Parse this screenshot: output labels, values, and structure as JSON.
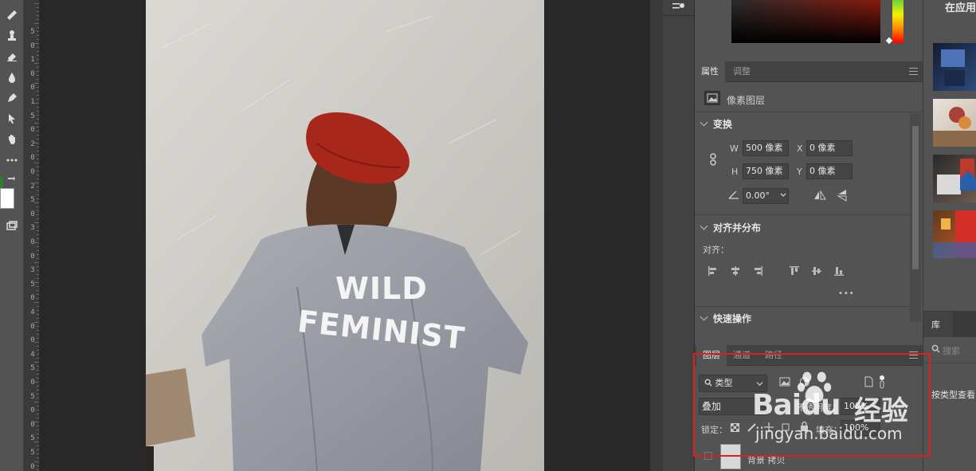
{
  "ruler": {
    "labels": [
      "5",
      "0",
      "1",
      "0",
      "0",
      "1",
      "5",
      "0",
      "2",
      "0",
      "0",
      "2",
      "5",
      "0",
      "3",
      "0",
      "0",
      "3",
      "5",
      "0",
      "4",
      "0",
      "0",
      "4",
      "5",
      "0",
      "5",
      "0",
      "0",
      "5",
      "5",
      "0",
      "6"
    ]
  },
  "artwork": {
    "shirt_text_line1": "WILD",
    "shirt_text_line2": "FEMINIST"
  },
  "properties": {
    "tabs": [
      "属性",
      "调整"
    ],
    "layer_type": "像素图层",
    "transform": {
      "title": "变换",
      "w_label": "W",
      "w_value": "500 像素",
      "h_label": "H",
      "h_value": "750 像素",
      "x_label": "X",
      "x_value": "0 像素",
      "y_label": "Y",
      "y_value": "0 像素",
      "angle_value": "0.00°"
    },
    "align": {
      "title": "对齐并分布",
      "label": "对齐：",
      "more": "•••"
    },
    "quick": {
      "title": "快速操作"
    }
  },
  "layers": {
    "tabs": [
      "图层",
      "通道",
      "路径"
    ],
    "filter_kind": "类型",
    "blend_mode": "叠加",
    "opacity_label": "不透明度：",
    "opacity_value": "100%",
    "lock_label": "锁定：",
    "fill_label": "填充：",
    "fill_value": "100%",
    "layer_name": "背景 拷贝"
  },
  "right_strip": {
    "title": "在应用",
    "library_tab": "库",
    "search_placeholder": "搜索",
    "sort_text": "按类型查看"
  },
  "watermark": {
    "brand": "Baidu",
    "brand_cn": "经验",
    "url": "jingyan.baidu.com"
  },
  "colors": {
    "highlight": "#e0201c",
    "panel": "#535353",
    "beret": "#a8271b"
  }
}
